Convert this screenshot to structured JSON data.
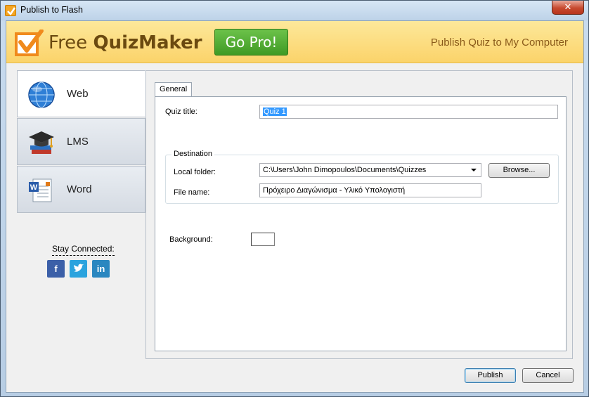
{
  "window": {
    "title": "Publish to Flash",
    "close_label": "✕"
  },
  "banner": {
    "logo_free": "Free ",
    "logo_name": "QuizMaker",
    "gopro_label": "Go Pro!",
    "right_text": "Publish Quiz to My Computer"
  },
  "sidebar": {
    "items": [
      {
        "label": "Web",
        "icon": "globe-icon"
      },
      {
        "label": "LMS",
        "icon": "graduation-cap-icon"
      },
      {
        "label": "Word",
        "icon": "word-document-icon"
      }
    ],
    "stay_connected": "Stay Connected:",
    "social": [
      {
        "label": "f",
        "icon": "facebook-icon",
        "color": "#3b5fa8"
      },
      {
        "label": "🐦",
        "icon": "twitter-icon",
        "color": "#2aa3de"
      },
      {
        "label": "in",
        "icon": "linkedin-icon",
        "color": "#2a87c0"
      }
    ]
  },
  "panel": {
    "tab_label": "General",
    "quiz_title_label": "Quiz title:",
    "quiz_title_value": "Quiz 1",
    "destination_label": "Destination",
    "local_folder_label": "Local folder:",
    "local_folder_value": "C:\\Users\\John Dimopoulos\\Documents\\Quizzes",
    "browse_label": "Browse...",
    "file_name_label": "File name:",
    "file_name_value": "Πρόχειρο Διαγώνισμα - Υλικό Υπολογιστή",
    "background_label": "Background:",
    "background_color": "#ffffff"
  },
  "footer": {
    "publish_label": "Publish",
    "cancel_label": "Cancel"
  },
  "colors": {
    "accent_green": "#4aa82c",
    "banner_yellow": "#fbd36a"
  }
}
